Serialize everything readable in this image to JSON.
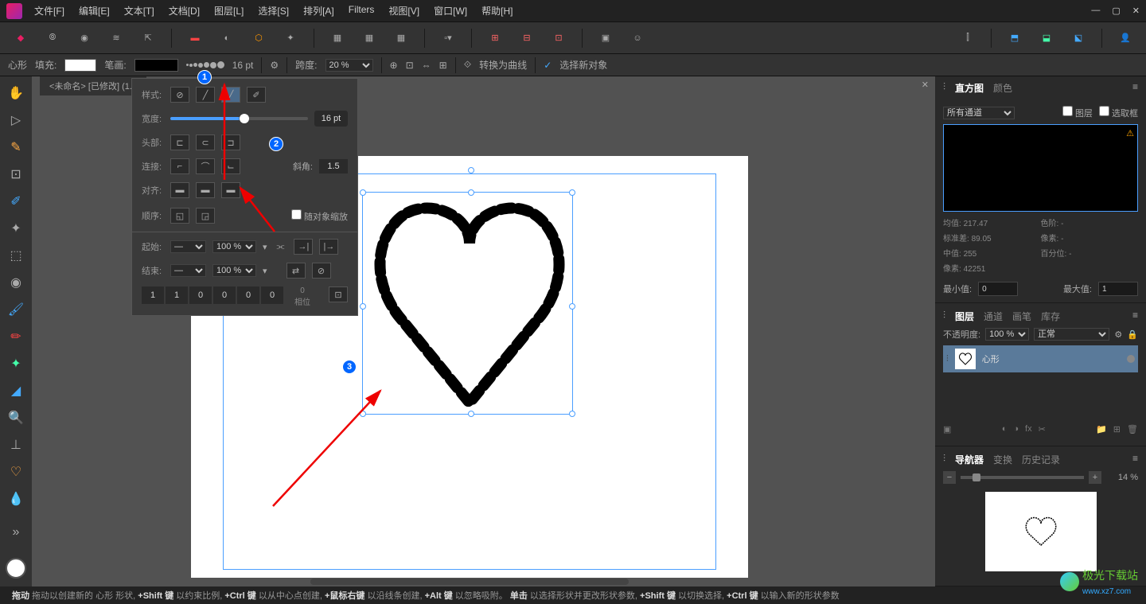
{
  "menu": {
    "items": [
      "文件[F]",
      "编辑[E]",
      "文本[T]",
      "文档[D]",
      "图层[L]",
      "选择[S]",
      "排列[A]",
      "Filters",
      "视图[V]",
      "窗口[W]",
      "帮助[H]"
    ]
  },
  "context": {
    "tool_name": "心形",
    "fill_label": "填充:",
    "stroke_label": "笔画:",
    "stroke_width": "16 pt",
    "span_label": "跨度:",
    "span_value": "20 %",
    "convert_label": "转换为曲线",
    "select_new_label": "选择新对象"
  },
  "doc_tab": "<未命名> [已修改] (1...",
  "stroke_panel": {
    "style_label": "样式:",
    "width_label": "宽度:",
    "width_value": "16 pt",
    "cap_label": "头部:",
    "join_label": "连接:",
    "miter_label": "斜角:",
    "miter_value": "1.5",
    "align_label": "对齐:",
    "order_label": "顺序:",
    "scale_label": "随对象缩放",
    "start_label": "起始:",
    "end_label": "结束:",
    "percent": "100 %",
    "dash_values": [
      "1",
      "1",
      "0",
      "0",
      "0",
      "0"
    ],
    "dash_last_label": "0",
    "phase_label": "相位"
  },
  "right": {
    "histogram_tab": "直方图",
    "color_tab": "颜色",
    "channels_label": "所有通道",
    "layer_checkbox": "图层",
    "selection_checkbox": "选取框",
    "stats": {
      "mean_label": "均值:",
      "mean_value": "217.47",
      "stddev_label": "标准差:",
      "stddev_value": "89.05",
      "median_label": "中值:",
      "median_value": "255",
      "pixels_label": "像素:",
      "pixels_value": "42251",
      "levels_label": "色阶:",
      "levels_value": "-",
      "ps_label": "像素:",
      "ps_value": "-",
      "percent_label": "百分位:",
      "percent_value": "-"
    },
    "min_label": "最小值:",
    "min_value": "0",
    "max_label": "最大值:",
    "max_value": "1",
    "layers_tab": "图层",
    "channels_tab": "通道",
    "brushes_tab": "画笔",
    "stock_tab": "库存",
    "opacity_label": "不透明度:",
    "opacity_value": "100 %",
    "blend_mode": "正常",
    "layer_name": "心形",
    "navigator_tab": "导航器",
    "transform_tab": "变换",
    "history_tab": "历史记录",
    "zoom_value": "14 %"
  },
  "status": {
    "parts": [
      {
        "b": "拖动",
        "t": " 拖动以创建新的 心形 形状,  "
      },
      {
        "b": "+Shift 键",
        "t": " 以约束比例,  "
      },
      {
        "b": "+Ctrl 键",
        "t": " 以从中心点创建,  "
      },
      {
        "b": "+鼠标右键",
        "t": " 以沿线条创建,  "
      },
      {
        "b": "+Alt 键",
        "t": " 以忽略吸附。  "
      },
      {
        "b": "单击",
        "t": " 以选择形状并更改形状参数,  "
      },
      {
        "b": "+Shift 键",
        "t": " 以切换选择,  "
      },
      {
        "b": "+Ctrl 键",
        "t": " 以输入新的形状参数"
      }
    ]
  },
  "watermark": {
    "text": "极光下载站",
    "url": "www.xz7.com"
  }
}
